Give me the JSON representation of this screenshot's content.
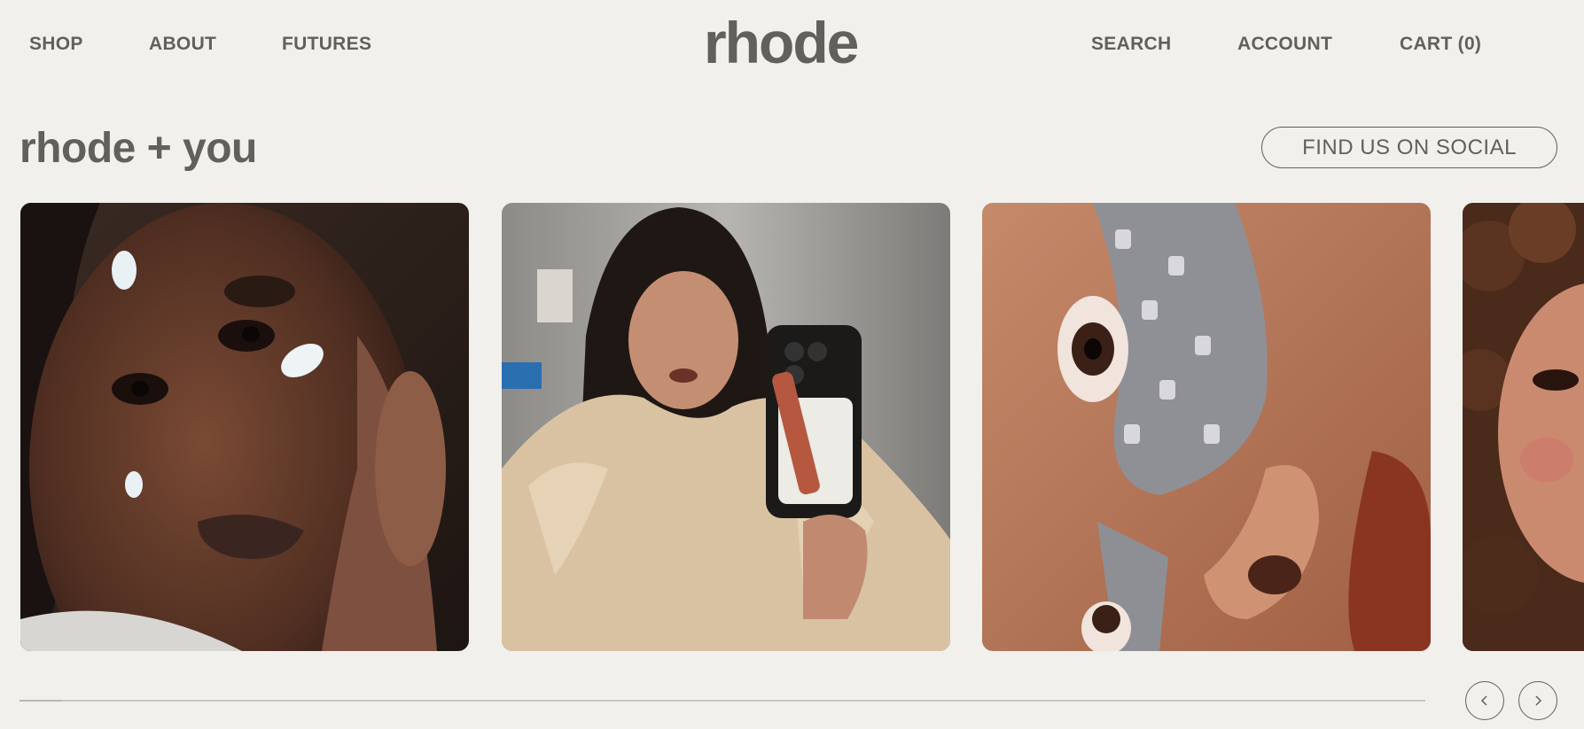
{
  "header": {
    "nav_left": [
      "SHOP",
      "ABOUT",
      "FUTURES"
    ],
    "logo": "rhode",
    "nav_right": [
      "SEARCH",
      "ACCOUNT",
      "CART (0)"
    ]
  },
  "section": {
    "title": "rhode + you",
    "social_button": "FIND US ON SOCIAL"
  },
  "carousel": {
    "cards": [
      {
        "icon": "face-with-cream-dots-photo"
      },
      {
        "icon": "mirror-selfie-with-phone-case-photo"
      },
      {
        "icon": "eye-patch-closeup-photo"
      },
      {
        "icon": "curly-hair-portrait-photo"
      }
    ],
    "progress_fraction": 0.03
  },
  "colors": {
    "background": "#f1f0ed",
    "text": "#625f5c",
    "track": "#c9c7c3"
  }
}
